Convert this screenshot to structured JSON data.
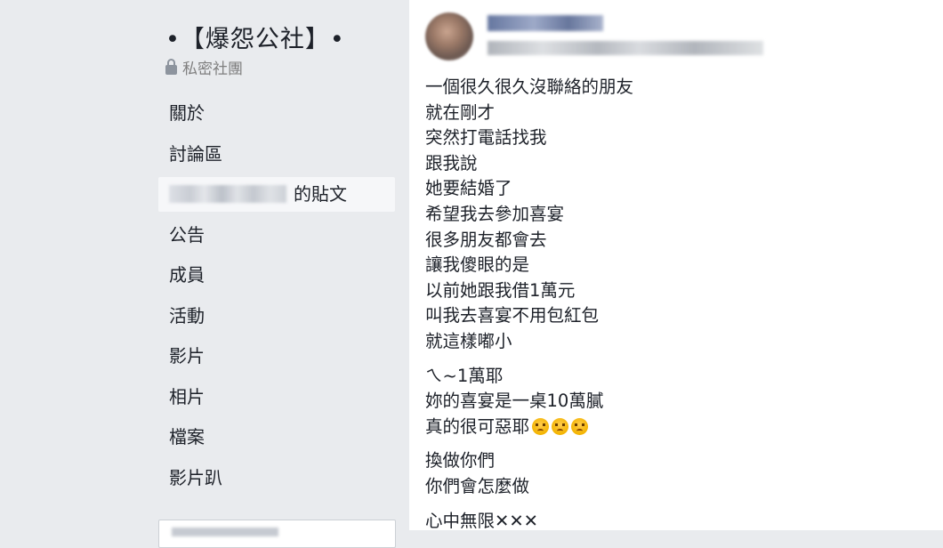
{
  "group": {
    "name": "•【爆怨公社】•",
    "privacy_label": "私密社團"
  },
  "sidebar": {
    "items": [
      {
        "label": "關於"
      },
      {
        "label": "討論區"
      },
      {
        "label": "的貼文",
        "active": true
      },
      {
        "label": "公告"
      },
      {
        "label": "成員"
      },
      {
        "label": "活動"
      },
      {
        "label": "影片"
      },
      {
        "label": "相片"
      },
      {
        "label": "檔案"
      },
      {
        "label": "影片趴"
      }
    ]
  },
  "post": {
    "paragraphs": [
      [
        "一個很久很久沒聯絡的朋友",
        "就在剛才",
        "突然打電話找我",
        "跟我說",
        "她要結婚了",
        "希望我去參加喜宴",
        "很多朋友都會去",
        "讓我傻眼的是",
        "以前她跟我借1萬元",
        "叫我去喜宴不用包紅包",
        "就這樣嘟小"
      ],
      [
        "ㄟ~1萬耶",
        "妳的喜宴是一桌10萬膩",
        "真的很可惡耶"
      ],
      [
        "換做你們",
        "你們會怎麼做"
      ],
      [
        "心中無限✕✕✕"
      ]
    ],
    "emoji_name": "angry-face-emoji",
    "emoji_count": 3
  },
  "colors": {
    "sidebar_bg": "#e9ebee",
    "active_item_bg": "#f6f7f9",
    "post_bg": "#ffffff",
    "text": "#1d2129",
    "muted_text": "#7f7f7f"
  }
}
